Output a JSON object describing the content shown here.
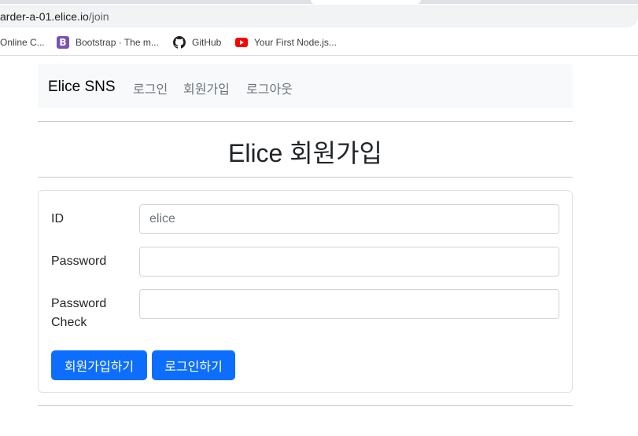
{
  "browser": {
    "url_host": "arder-a-01.elice.io",
    "url_path": "/join",
    "bookmarks": [
      {
        "label": "Online C...",
        "icon": "globe-icon"
      },
      {
        "label": "Bootstrap · The m...",
        "icon": "bootstrap-icon",
        "icon_text": "B",
        "color": "#7952b3"
      },
      {
        "label": "GitHub",
        "icon": "github-icon"
      },
      {
        "label": "Your First Node.js...",
        "icon": "youtube-icon",
        "color": "#ff0000"
      }
    ]
  },
  "navbar": {
    "brand": "Elice SNS",
    "links": [
      "로그인",
      "회원가입",
      "로그아웃"
    ]
  },
  "page": {
    "title": "Elice 회원가입"
  },
  "form": {
    "id_label": "ID",
    "id_placeholder": "elice",
    "id_value": "",
    "password_label": "Password",
    "password_value": "",
    "password_check_label_line1": "Password",
    "password_check_label_line2": "Check",
    "password_check_value": "",
    "submit_label": "회원가입하기",
    "login_label": "로그인하기"
  },
  "colors": {
    "primary": "#0d6efd",
    "navbar_bg": "#f8f9fa",
    "nav_link": "#6c757d"
  }
}
